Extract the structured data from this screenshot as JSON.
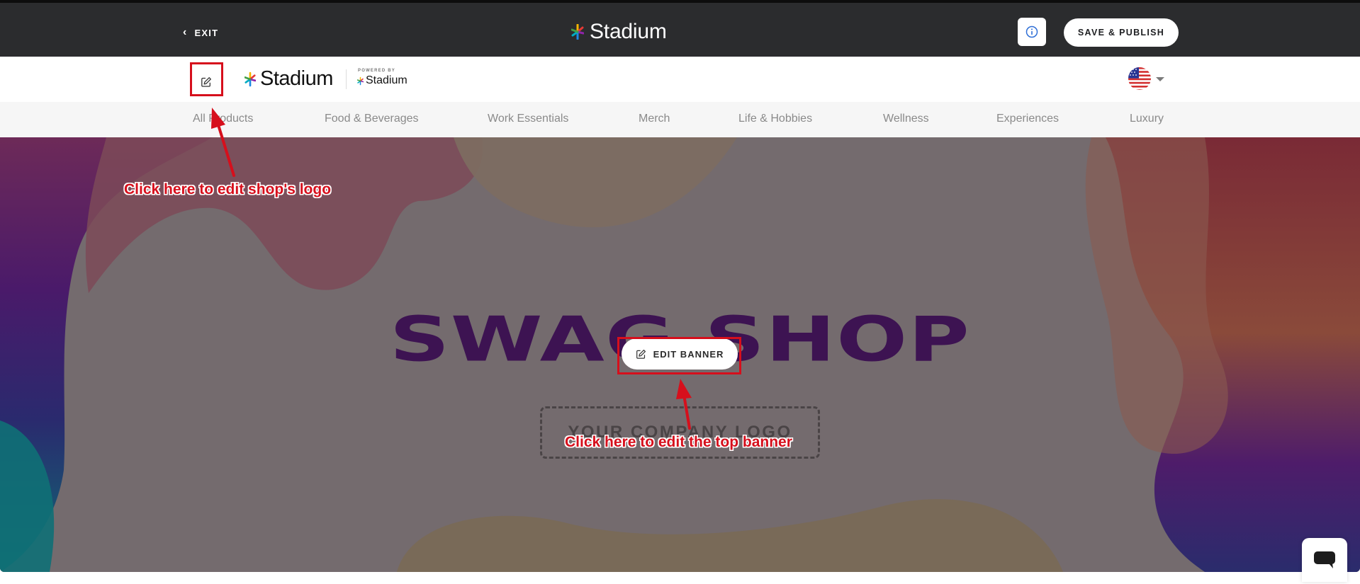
{
  "topbar": {
    "exit_label": "EXIT",
    "brand": "Stadium",
    "info_icon": "info-icon",
    "publish_label": "SAVE & PUBLISH"
  },
  "shop_header": {
    "edit_logo_icon": "edit-icon",
    "shop_brand": "Stadium",
    "powered_by_label": "POWERED BY",
    "powered_by_brand": "Stadium",
    "locale_flag": "us-flag-icon"
  },
  "categories": [
    "All Products",
    "Food & Beverages",
    "Work Essentials",
    "Merch",
    "Life & Hobbies",
    "Wellness",
    "Experiences",
    "Luxury"
  ],
  "banner": {
    "title": "SWAG SHOP",
    "logo_placeholder": "YOUR COMPANY LOGO",
    "edit_banner_label": "EDIT BANNER"
  },
  "annotations": {
    "logo_hint": "Click here to edit shop's logo",
    "banner_hint": "Click here to edit the top banner"
  },
  "colors": {
    "topbar_bg": "#2b2c2e",
    "annotation_red": "#d60f1c",
    "title_purple": "#3d1352",
    "info_blue": "#2f6fd6"
  },
  "chat": {
    "icon": "chat-icon"
  }
}
